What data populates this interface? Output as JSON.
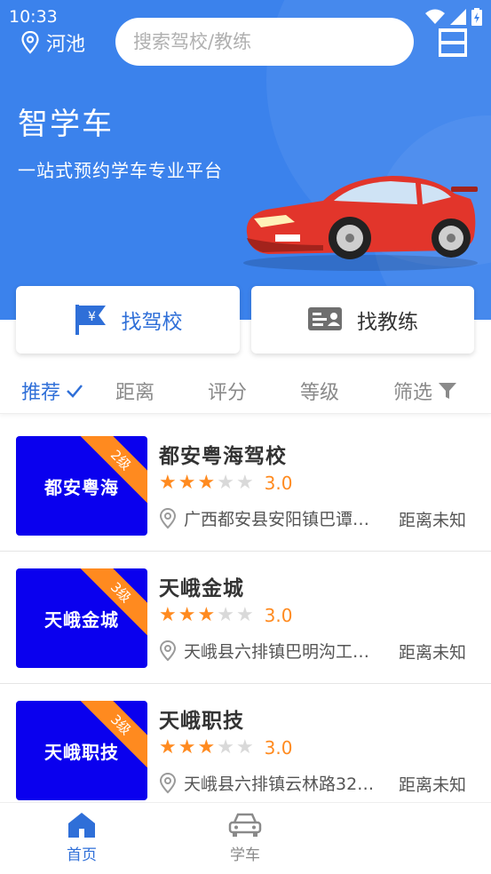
{
  "status_bar": {
    "time": "10:33"
  },
  "header": {
    "location": "河池",
    "search_placeholder": "搜索驾校/教练",
    "title": "智学车",
    "subtitle": "一站式预约学车专业平台"
  },
  "actions": {
    "find_school": "找驾校",
    "find_coach": "找教练"
  },
  "filters": {
    "items": [
      "推荐",
      "距离",
      "评分",
      "等级",
      "筛选"
    ],
    "active": "推荐"
  },
  "schools": [
    {
      "name": "都安粤海驾校",
      "thumb_label": "都安粤海",
      "level": "2级",
      "rating": 3,
      "score": "3.0",
      "address": "广西都安县安阳镇巴谭…",
      "distance": "距离未知"
    },
    {
      "name": "天峨金城",
      "thumb_label": "天峨金城",
      "level": "3级",
      "rating": 3,
      "score": "3.0",
      "address": "天峨县六排镇巴明沟工…",
      "distance": "距离未知"
    },
    {
      "name": "天峨职技",
      "thumb_label": "天峨职技",
      "level": "3级",
      "rating": 3,
      "score": "3.0",
      "address": "天峨县六排镇云林路32…",
      "distance": "距离未知"
    }
  ],
  "bottom_nav": {
    "home": "首页",
    "learn": "学车"
  },
  "colors": {
    "primary": "#3b82ec",
    "accent": "#ff8a1f",
    "thumb_bg": "#0a00ee"
  }
}
